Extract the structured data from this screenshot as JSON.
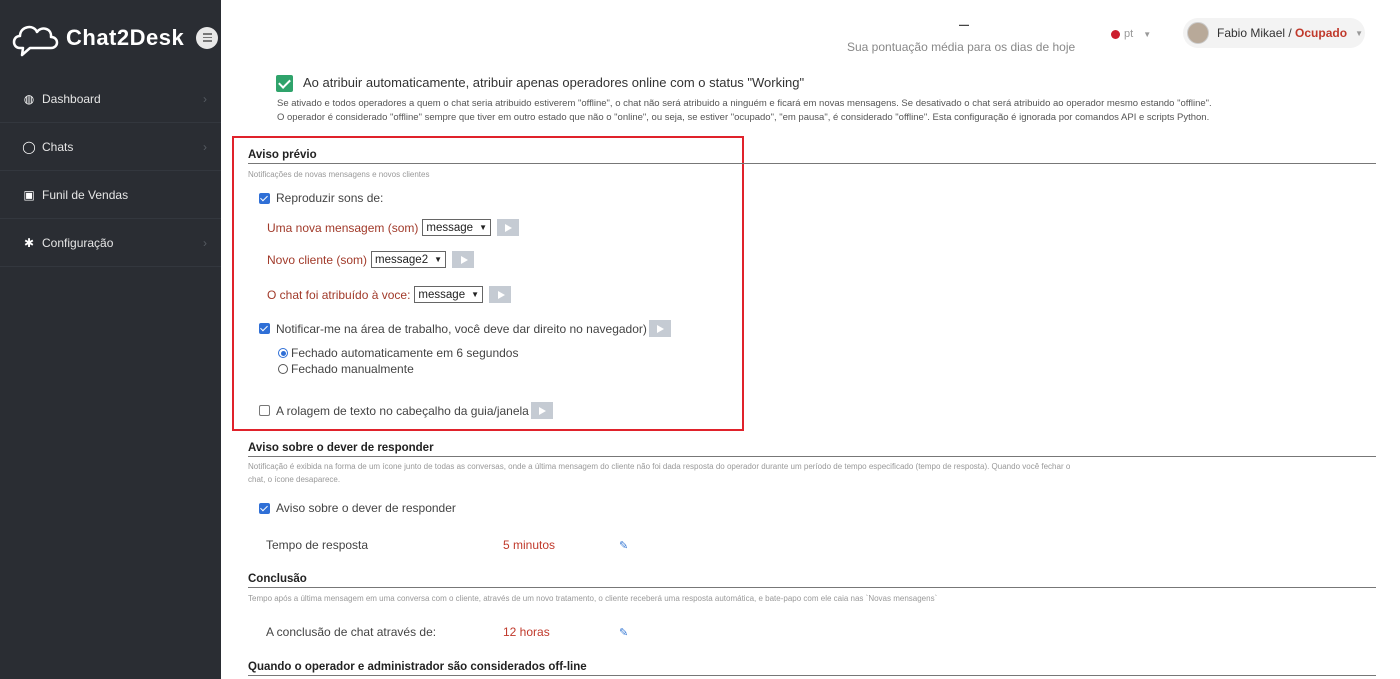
{
  "app": {
    "logo_text": "Chat2Desk"
  },
  "sidebar": {
    "items": [
      {
        "label": "Dashboard",
        "icon": "dashboard-icon"
      },
      {
        "label": "Chats",
        "icon": "chat-bubble-icon"
      },
      {
        "label": "Funil de Vendas",
        "icon": "funnel-icon"
      },
      {
        "label": "Configuração",
        "icon": "gear-icon"
      }
    ]
  },
  "header": {
    "score_value": "–",
    "score_label": "Sua pontuação média para os dias de hoje",
    "language": "pt",
    "user_name": "Fabio Mikael",
    "user_separator": " / ",
    "user_status": "Ocupado"
  },
  "auto_assign": {
    "checked": true,
    "title": "Ao atribuir automaticamente, atribuir apenas operadores online com o status \"Working\"",
    "desc_line1": "Se ativado e todos operadores a quem o chat seria atribuido estiverem \"offline\", o chat não será atribuido a ninguém e ficará em novas mensagens. Se desativado o chat será atribuido ao operador mesmo estando \"offline\".",
    "desc_line2": "O operador é considerado \"offline\" sempre que tiver em outro estado que não o \"online\", ou seja, se estiver \"ocupado\", \"em pausa\", é considerado \"offline\". Esta configuração é ignorada por comandos API e scripts Python."
  },
  "aviso_previo": {
    "title": "Aviso prévio",
    "desc": "Notificações de novas mensagens e novos clientes",
    "play_sounds_label": "Reproduzir sons de:",
    "new_message_label": "Uma nova mensagem (som)",
    "new_message_value": "message",
    "new_client_label": "Novo cliente (som)",
    "new_client_value": "message2",
    "assigned_label": "O chat foi atribuído à voce:",
    "assigned_value": "message",
    "desktop_notify_label": "Notificar-me na área de trabalho, você deve dar direito no navegador)",
    "radio_auto_label": "Fechado automaticamente em 6 segundos",
    "radio_manual_label": "Fechado manualmente",
    "scroll_label": "A rolagem de texto no cabeçalho da guia/janela"
  },
  "dever_responder": {
    "title": "Aviso sobre o dever de responder",
    "desc_line1": "Notificação é exibida na forma de um ícone junto de todas as conversas, onde a última mensagem do cliente não foi dada resposta do operador durante um período de tempo especificado (tempo de resposta). Quando você fechar o",
    "desc_line2": "chat, o ícone desaparece.",
    "checkbox_label": "Aviso sobre o dever de responder",
    "response_time_label": "Tempo de resposta",
    "response_time_value": "5 minutos"
  },
  "conclusao": {
    "title": "Conclusão",
    "desc": "Tempo após a última mensagem em uma conversa com o cliente, através de um novo tratamento, o cliente receberá uma resposta automática, e bate-papo com ele caia nas `Novas mensagens`",
    "label": "A conclusão de chat através de:",
    "value": "12 horas"
  },
  "offline": {
    "title": "Quando o operador e administrador são considerados off-line"
  },
  "colors": {
    "sidebar_bg": "#2a2d33",
    "highlight": "#e0222b",
    "accent_blue": "#2f6fd6",
    "status_red": "#c0392b"
  }
}
